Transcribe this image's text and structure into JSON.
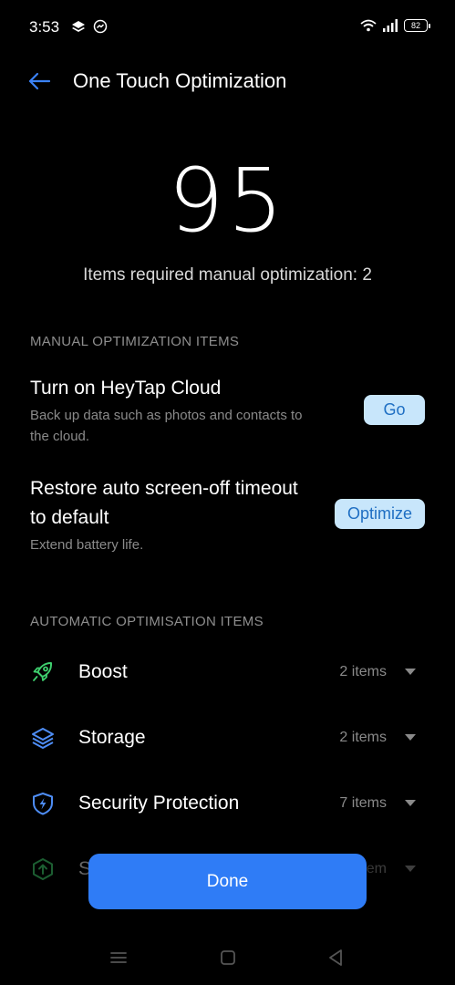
{
  "status_bar": {
    "time": "3:53",
    "battery": "82"
  },
  "header": {
    "title": "One Touch Optimization"
  },
  "score": {
    "value": "95",
    "subtitle": "Items required manual optimization: 2"
  },
  "manual_section": {
    "header": "MANUAL OPTIMIZATION ITEMS",
    "items": [
      {
        "title": "Turn on HeyTap Cloud",
        "description": "Back up data such as photos and contacts to the cloud.",
        "button": "Go"
      },
      {
        "title": "Restore auto screen-off timeout to default",
        "description": "Extend battery life.",
        "button": "Optimize"
      }
    ]
  },
  "auto_section": {
    "header": "AUTOMATIC OPTIMISATION ITEMS",
    "items": [
      {
        "label": "Boost",
        "count": "2 items",
        "icon": "rocket-icon",
        "color": "#3ecf6e"
      },
      {
        "label": "Storage",
        "count": "2 items",
        "icon": "layers-icon",
        "color": "#4e8df5"
      },
      {
        "label": "Security Protection",
        "count": "7 items",
        "icon": "shield-icon",
        "color": "#4e8df5"
      },
      {
        "label": "S",
        "count": "em",
        "icon": "upload-icon",
        "color": "#3ecf6e"
      }
    ]
  },
  "done_button": {
    "label": "Done",
    "color": "#2f7cf6"
  },
  "accent_color": "#2f7cf6"
}
